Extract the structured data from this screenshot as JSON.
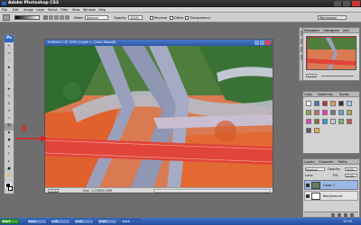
{
  "app": {
    "title": "Adobe Photoshop CS3"
  },
  "menu": [
    "File",
    "Edit",
    "Image",
    "Layer",
    "Select",
    "Filter",
    "View",
    "Window",
    "Help"
  ],
  "options": {
    "mode_label": "Mode:",
    "mode_value": "Normal",
    "opacity_label": "Opacity:",
    "opacity_value": "100%",
    "reverse_label": "Reverse",
    "dither_label": "Dither",
    "transparency_label": "Transparency",
    "workspace_label": "Workspace"
  },
  "toolbox": {
    "logo": "Ps"
  },
  "document": {
    "title": "Untitled-1 @ 100% (Layer 1, Quick Mask/8)",
    "zoom": "100%",
    "doc_info": "Doc: 1.03M/3.09M"
  },
  "annotation": {
    "label": "4"
  },
  "panels": {
    "navigator": {
      "tabs": [
        "Navigator",
        "Histogram",
        "Info"
      ],
      "zoom": "100%"
    },
    "color": {
      "tabs": [
        "Color",
        "Swatches",
        "Styles"
      ]
    },
    "layers": {
      "tabs": [
        "Layers",
        "Channels",
        "Paths"
      ],
      "blend": "Normal",
      "opacity_label": "Opacity:",
      "opacity_value": "100%",
      "lock_label": "Lock:",
      "fill_label": "Fill:",
      "fill_value": "100%",
      "rows": [
        {
          "name": "Layer 1"
        },
        {
          "name": "Background"
        }
      ]
    }
  },
  "taskbar": {
    "items": [
      "start",
      "Adob",
      "5 Mi",
      "Untit",
      "Untitl",
      "Adob"
    ],
    "time": "10:45"
  },
  "colors": {
    "quickmask_red": "#e22626",
    "selection_blue": "#3a64c8",
    "road_lane": "#b8bcc8"
  }
}
